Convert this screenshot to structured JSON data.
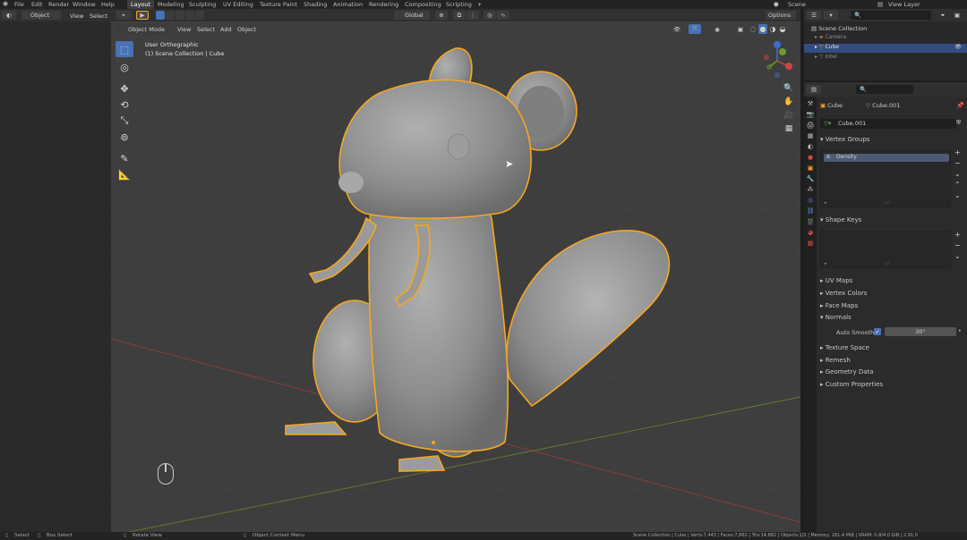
{
  "menu": {
    "items": [
      "File",
      "Edit",
      "Render",
      "Window",
      "Help"
    ]
  },
  "workspaces": [
    "Layout",
    "Modeling",
    "Sculpting",
    "UV Editing",
    "Texture Paint",
    "Shading",
    "Animation",
    "Rendering",
    "Compositing",
    "Scripting"
  ],
  "active_workspace": "Layout",
  "scene_name": "Scene",
  "view_layer": "View Layer",
  "left_header": {
    "mode": "Object",
    "view": "View",
    "select": "Select"
  },
  "viewport_header": {
    "mode": "Object Mode",
    "view": "View",
    "select": "Select",
    "add": "Add",
    "object": "Object",
    "transform": "Global",
    "options": "Options"
  },
  "viewport_info": {
    "line1": "User Orthographic",
    "line2": "(1) Scene Collection | Cube"
  },
  "gizmo": {
    "x": "X",
    "y": "Y",
    "z": "Z"
  },
  "outliner": {
    "root": "Scene Collection",
    "items": [
      {
        "label": "Camera",
        "selected": false
      },
      {
        "label": "Cube",
        "selected": true
      },
      {
        "label": "Intel",
        "selected": false
      }
    ]
  },
  "properties": {
    "object_name": "Cube",
    "data_name": "Cube.001",
    "mesh_field": "Cube.001",
    "vertex_groups_title": "Vertex Groups",
    "vertex_group_item": "Density",
    "shape_keys_title": "Shape Keys",
    "sections": [
      "UV Maps",
      "Vertex Colors",
      "Face Maps",
      "Normals"
    ],
    "auto_smooth_label": "Auto Smooth",
    "auto_smooth_value": "30°",
    "sections_after": [
      "Texture Space",
      "Remesh",
      "Geometry Data",
      "Custom Properties"
    ]
  },
  "statusbar": {
    "select": "Select",
    "box_select": "Box Select",
    "rotate_view": "Rotate View",
    "context_menu": "Object Context Menu",
    "stats": "Scene Collection | Cube | Verts:7,443 | Faces:7,862 | Tris:14,882 | Objects:1/1 | Memory: 181.4 MiB | VRAM: 0.8/4.0 GiB | 2.91.0"
  },
  "colors": {
    "selection_outline": "#f5a623",
    "active_blue": "#4772b3",
    "model_gray": "#8f8f8f",
    "viewport_bg": "#3e3e3e"
  }
}
